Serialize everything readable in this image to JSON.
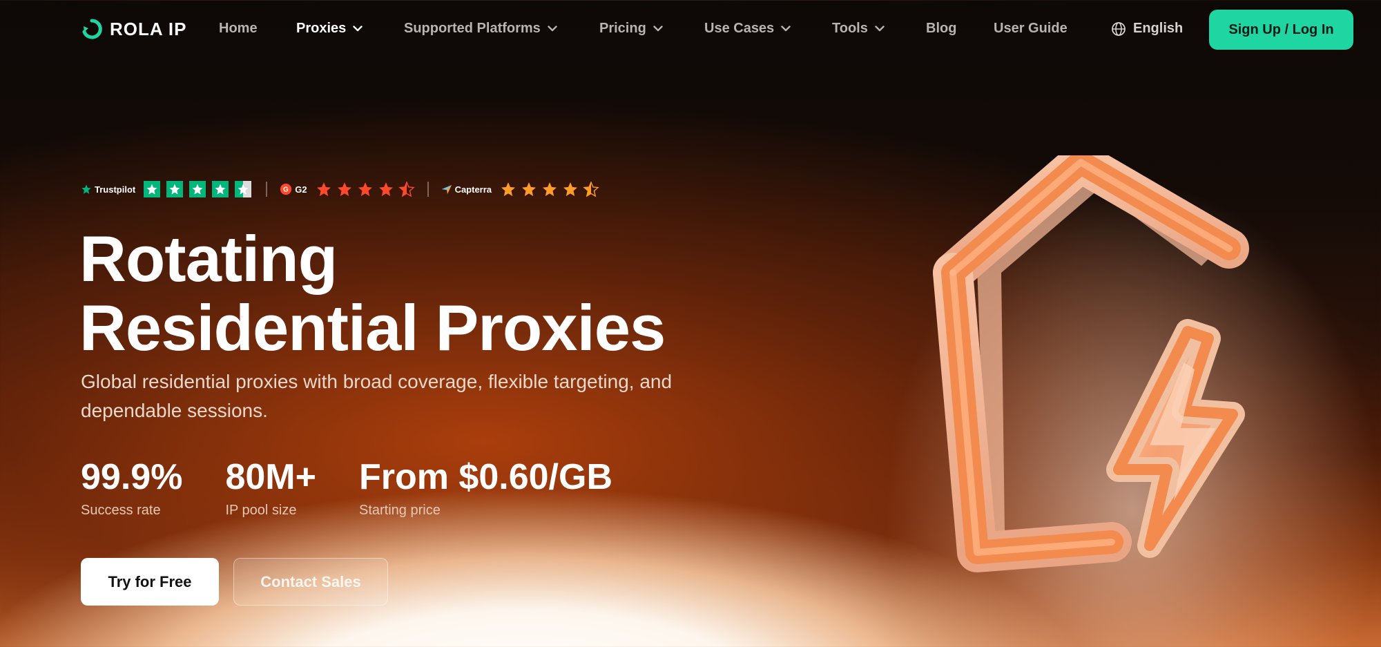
{
  "nav": {
    "brand": "ROLA IP",
    "items": [
      {
        "label": "Home",
        "dropdown": false,
        "active": false
      },
      {
        "label": "Proxies",
        "dropdown": true,
        "active": true
      },
      {
        "label": "Supported Platforms",
        "dropdown": true,
        "active": false
      },
      {
        "label": "Pricing",
        "dropdown": true,
        "active": false
      },
      {
        "label": "Use Cases",
        "dropdown": true,
        "active": false
      },
      {
        "label": "Tools",
        "dropdown": true,
        "active": false
      },
      {
        "label": "Blog",
        "dropdown": false,
        "active": false
      },
      {
        "label": "User Guide",
        "dropdown": false,
        "active": false
      }
    ],
    "language": "English",
    "cta": "Sign Up / Log In"
  },
  "ratings": {
    "trustpilot": {
      "label": "Trustpilot",
      "stars": 4.5,
      "color": "#00b67a"
    },
    "g2": {
      "label": "G2",
      "stars": 4.5,
      "color": "#ff492c"
    },
    "capterra": {
      "label": "Capterra",
      "stars": 4.5,
      "color": "#ff9d28"
    }
  },
  "hero": {
    "title_line1": "Rotating",
    "title_line2": "Residential Proxies",
    "subtitle": "Global residential proxies with broad coverage, flexible targeting, and dependable sessions.",
    "stats": [
      {
        "value": "99.9%",
        "label": "Success rate"
      },
      {
        "value": "80M+",
        "label": "IP pool size"
      },
      {
        "value": "From $0.60/GB",
        "label": "Starting price"
      }
    ],
    "primary_cta": "Try for Free",
    "secondary_cta": "Contact Sales"
  },
  "colors": {
    "accent": "#1fd5a2",
    "illustration": "#f08a4b"
  }
}
